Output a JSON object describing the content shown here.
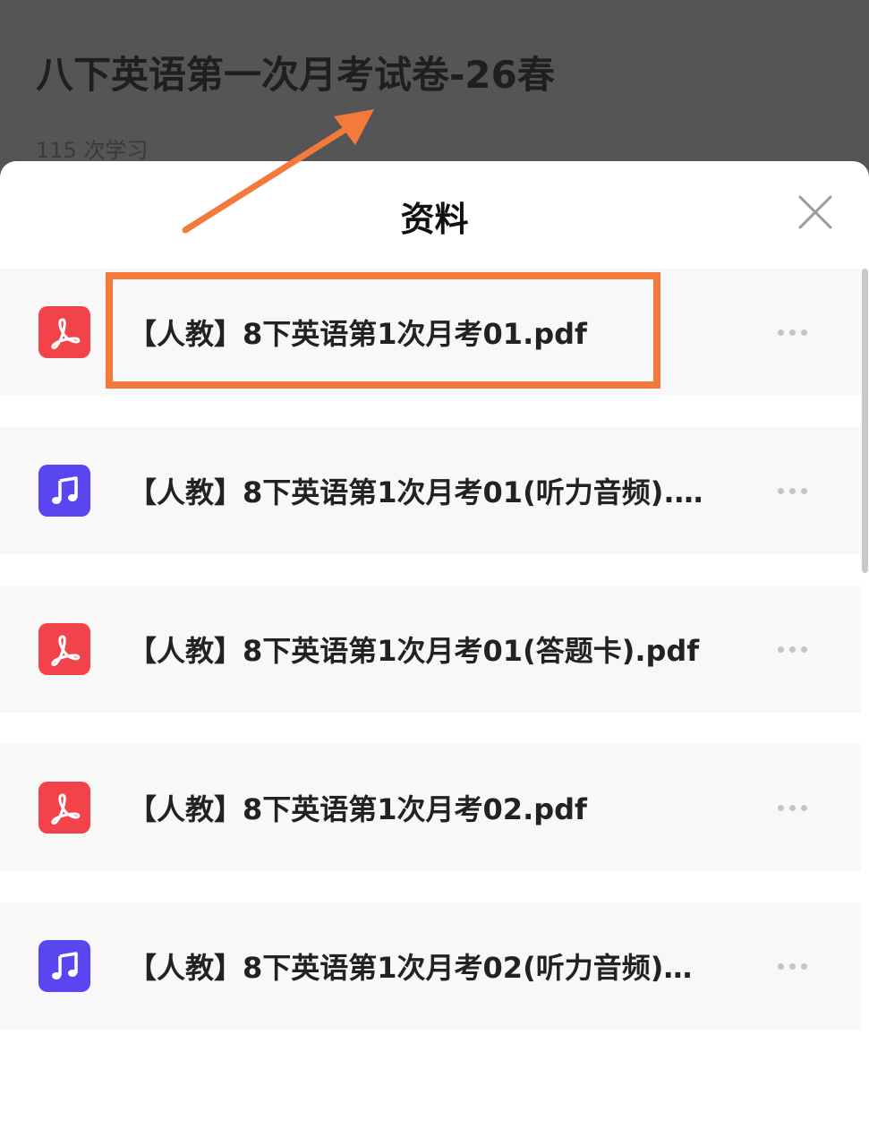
{
  "page": {
    "title": "八下英语第一次月考试卷-26春",
    "study_count": "115 次学习"
  },
  "sheet": {
    "title": "资料",
    "close_icon": "close-icon"
  },
  "files": [
    {
      "name": "【人教】8下英语第1次月考01.pdf",
      "type": "pdf",
      "icon": "pdf-icon"
    },
    {
      "name": "【人教】8下英语第1次月考01(听力音频).…",
      "type": "audio",
      "icon": "music-note-icon"
    },
    {
      "name": "【人教】8下英语第1次月考01(答题卡).pdf",
      "type": "pdf",
      "icon": "pdf-icon"
    },
    {
      "name": "【人教】8下英语第1次月考02.pdf",
      "type": "pdf",
      "icon": "pdf-icon"
    },
    {
      "name": "【人教】8下英语第1次月考02(听力音频)…",
      "type": "audio",
      "icon": "music-note-icon"
    }
  ],
  "annotation": {
    "color": "#f47a3c",
    "highlighted_index": 0
  },
  "colors": {
    "pdf_icon": "#f2434a",
    "audio_icon": "#5a46f0",
    "overlay": "#555555"
  }
}
